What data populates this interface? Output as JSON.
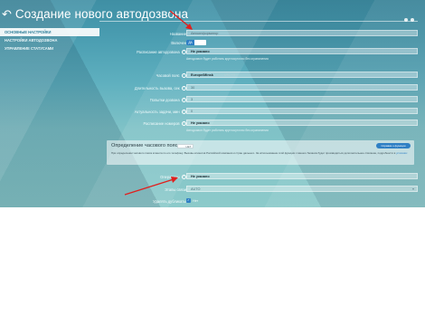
{
  "page": {
    "title": "Создание нового автодозвона"
  },
  "sidebar": {
    "items": [
      {
        "label": "ОСНОВНЫЕ НАСТРОЙКИ"
      },
      {
        "label": "НАСТРОЙКИ АВТОДОЗВОНА"
      },
      {
        "label": "УПРАВЛЕНИЕ СТАТУСАМИ"
      }
    ]
  },
  "form": {
    "name": {
      "label": "Название",
      "value": "Автоинформатор"
    },
    "enabled": {
      "label": "Включен",
      "toggle_text": "ДА"
    },
    "schedule": {
      "label": "Расписание автодозвона",
      "value": "Не указано",
      "hint": "Автодозвон будет работать круглосуточно без ограничения"
    },
    "timezone": {
      "label": "Часовой пояс",
      "value": "Europe/Minsk",
      "suffix": "UTC +3"
    },
    "ring_duration": {
      "label": "Длительность вызова, сек",
      "value": "30"
    },
    "attempts": {
      "label": "Попытки дозвона",
      "value": "3"
    },
    "task_relevance": {
      "label": "Актуальность задачи, мин",
      "value": "0"
    },
    "numbers_schedule": {
      "label": "Расписание номеров",
      "value": "Не указано",
      "hint": "Автодозвон будет работать круглосуточно без ограничения"
    },
    "operators": {
      "label": "Операторы",
      "value": "Не указано"
    },
    "route": {
      "label": "Этапы связи",
      "value": "AUTO"
    },
    "dedupe": {
      "label": "Удалять дубликаты",
      "checkbox_text": "Нет"
    }
  },
  "tz_panel": {
    "title": "Определение часового пояса",
    "toggle_text": "НЕТ",
    "button_label": "Справка о функции",
    "description": "При определении часового пояса клиента по его телефону. Вызовы клиентов Российской компании и стран дальнего. За использование этой функции с вашего баланса будет производиться дополнительное списание, подробности в",
    "link_text": "условиях"
  },
  "colors": {
    "accent": "#2e7fc4",
    "annotation_arrow": "#e0201e"
  }
}
